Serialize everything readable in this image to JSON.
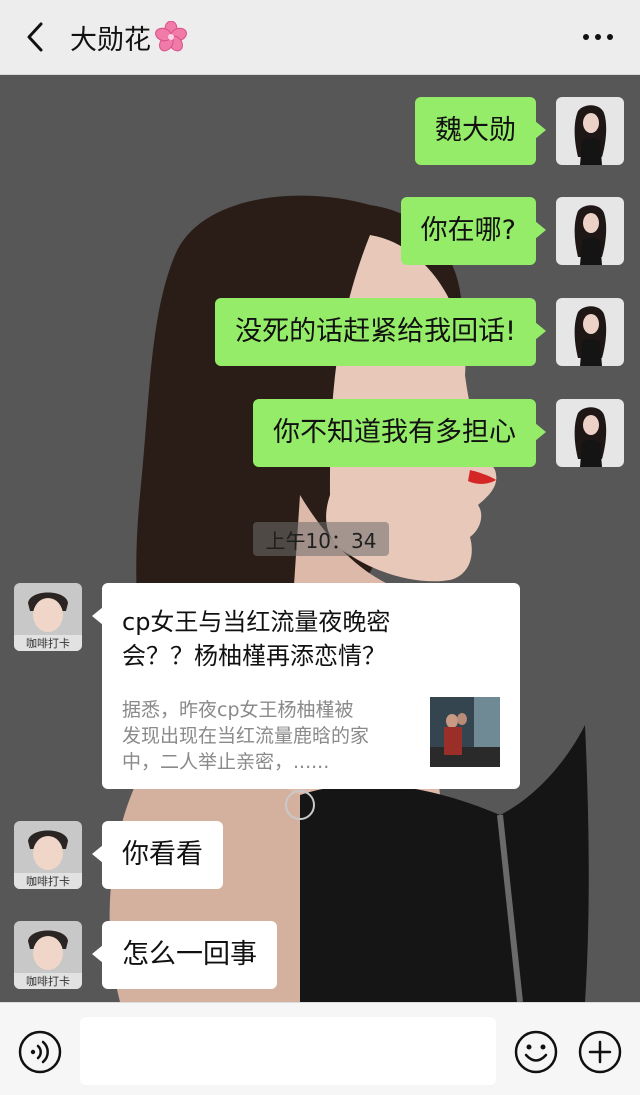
{
  "header": {
    "title": "大勋花",
    "back_icon": "chevron-left-icon",
    "title_emoji_icon": "cherry-blossom-icon",
    "more_icon": "more-dots-icon"
  },
  "messages_sent": [
    {
      "text": "魏大勋"
    },
    {
      "text": "你在哪?"
    },
    {
      "text": "没死的话赶紧给我回话!"
    },
    {
      "text": "你不知道我有多担心"
    }
  ],
  "timestamp": "上午10：34",
  "link_card": {
    "title": "cp女王与当红流量夜晚密\n会？？杨柚槿再添恋情？",
    "description": "据悉，昨夜cp女王杨柚槿被\n发现出现在当红流量鹿晗的家\n中，二人举止亲密，......"
  },
  "messages_received": [
    {
      "text": "你看看"
    },
    {
      "text": "怎么一回事"
    }
  ],
  "avatar_caption": "咖啡打卡",
  "input_bar": {
    "voice_icon": "voice-icon",
    "emoji_icon": "emoji-icon",
    "plus_icon": "plus-icon",
    "input_value": ""
  },
  "colors": {
    "header_bg": "#ededed",
    "sent_bubble": "#95ec69",
    "received_bubble": "#ffffff",
    "input_bar_bg": "#f6f6f6"
  }
}
